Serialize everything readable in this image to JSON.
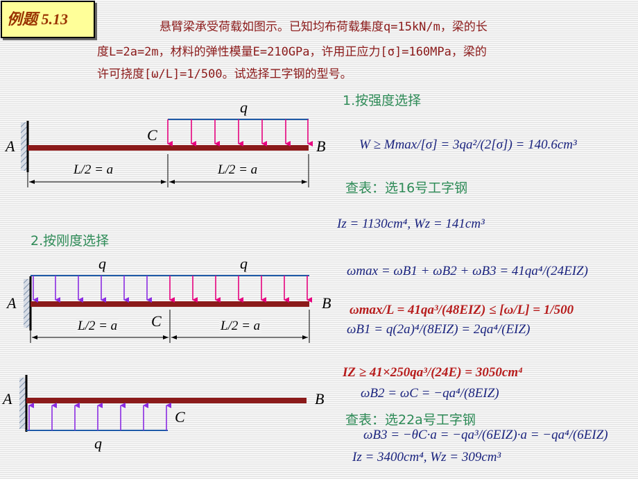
{
  "title_tag": "例题 5.13",
  "problem": {
    "line1": "悬臂梁承受荷载如图示。已知均布荷载集度q=15kN/m，梁的长",
    "line2": "度L=2a=2m，材料的弹性模量E=210GPa，许用正应力[σ]=160MPa，梁的",
    "line3": "许可挠度[ω/L]=1/500。试选择工字钢的型号。"
  },
  "step1": {
    "heading": "1.按强度选择",
    "formula": "W ≥ Mmax/[σ] = 3qa²/(2[σ]) = 140.6cm³",
    "lookup": "查表：选16号工字钢",
    "props": "Iz = 1130cm⁴,      Wz = 141cm³"
  },
  "step2": {
    "heading": "2.按刚度选择",
    "f1": "ωmax = ωB1 + ωB2 + ωB3 = 41qa⁴/(24EIZ)",
    "f2_blue": "ωB1 = q(2a)⁴/(8EIZ) = 2qa⁴/(EIZ)",
    "f2_red": "ωmax/L = 41qa³/(48EIZ) ≤ [ω/L] = 1/500",
    "f3_red": "IZ ≥ 41×250qa³/(24E) = 3050cm⁴",
    "f3_blue": "ωB2 = ωC = −qa⁴/(8EIZ)",
    "lookup": "查表：选22a号工字钢",
    "f4": "ωB3 = −θC·a = −qa³/(6EIZ)·a = −qa⁴/(6EIZ)",
    "props": "Iz = 3400cm⁴,      Wz = 309cm³"
  },
  "diagram": {
    "q": "q",
    "A": "A",
    "B": "B",
    "C": "C",
    "dim": "L/2 = a"
  },
  "colors": {
    "beam": "#8b1a1a",
    "red_arrow": "#e6007e",
    "purple_arrow": "#8a2be2",
    "load_line": "#1e5aa8",
    "wall": "#7a8fa8"
  }
}
